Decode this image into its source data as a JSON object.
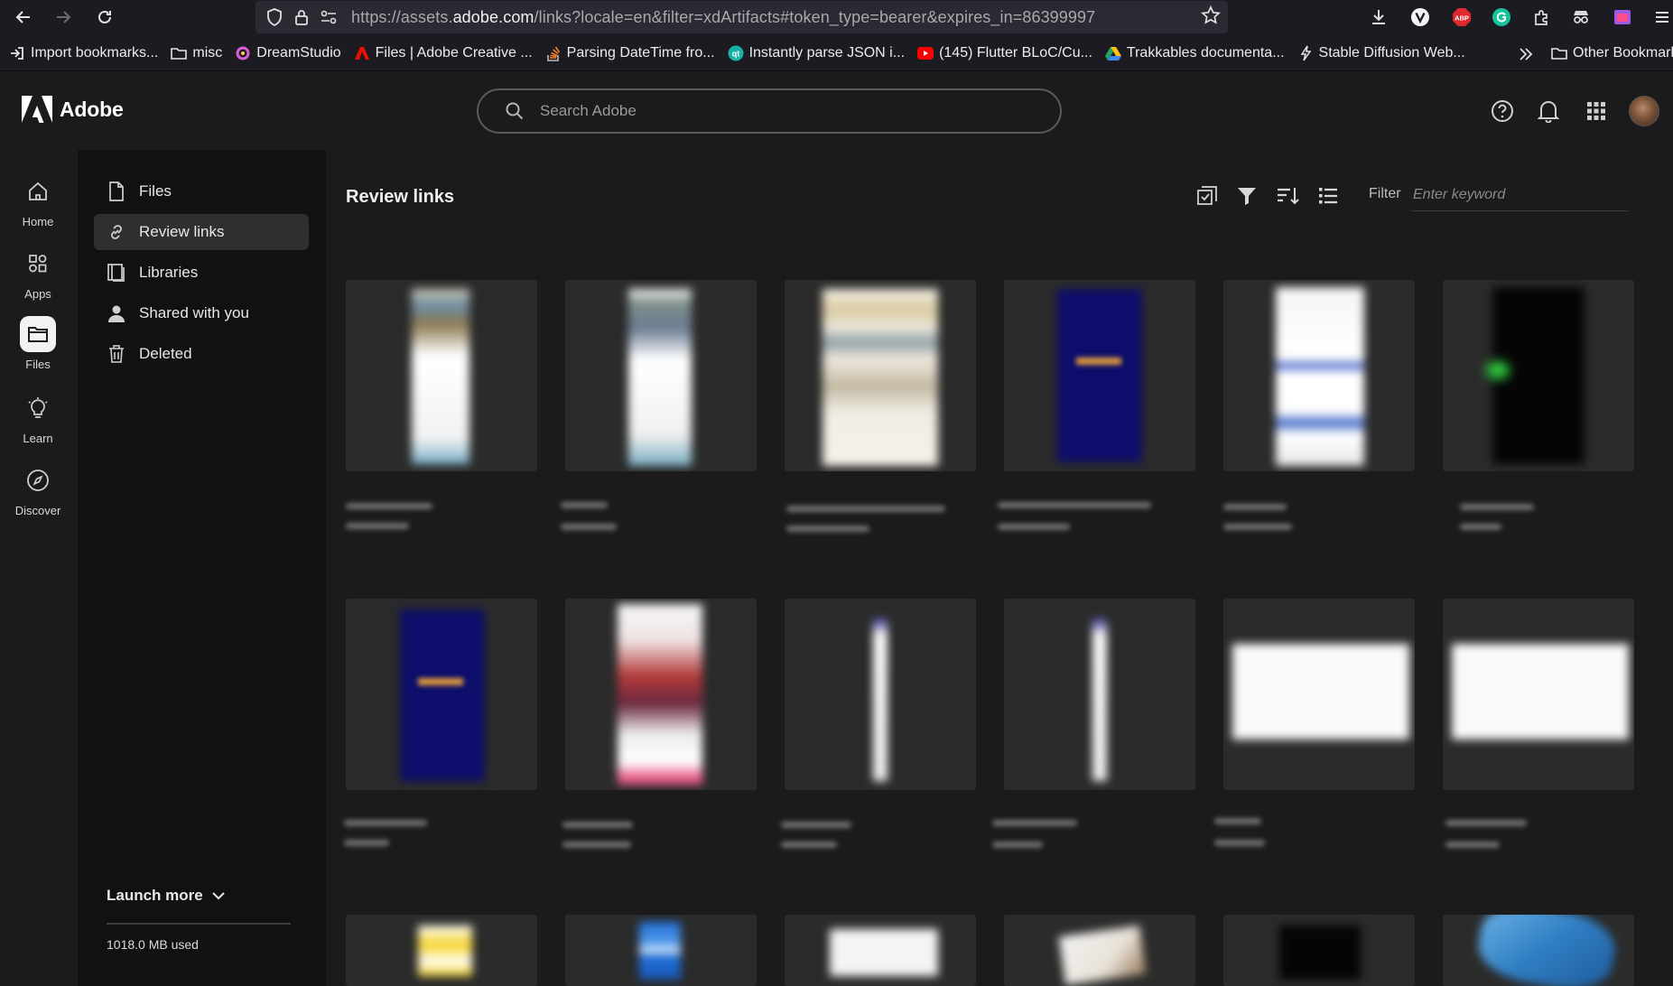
{
  "browser": {
    "url_prefix": "https://assets.",
    "url_domain": "adobe.com",
    "url_path": "/links?locale=en&filter=xdArtifacts#token_type=bearer&expires_in=86399997",
    "bookmarks": [
      {
        "label": "Import bookmarks..."
      },
      {
        "label": "misc"
      },
      {
        "label": "DreamStudio"
      },
      {
        "label": "Files | Adobe Creative ..."
      },
      {
        "label": "Parsing DateTime fro..."
      },
      {
        "label": "Instantly parse JSON i..."
      },
      {
        "label": "(145) Flutter BLoC/Cu..."
      },
      {
        "label": "Trakkables documenta..."
      },
      {
        "label": "Stable Diffusion Web..."
      }
    ],
    "other_bookmarks": "Other Bookmarks"
  },
  "header": {
    "brand": "Adobe",
    "search_placeholder": "Search Adobe"
  },
  "rail": {
    "items": [
      {
        "label": "Home"
      },
      {
        "label": "Apps"
      },
      {
        "label": "Files"
      },
      {
        "label": "Learn"
      },
      {
        "label": "Discover"
      }
    ]
  },
  "panel": {
    "items": [
      {
        "label": "Files"
      },
      {
        "label": "Review links"
      },
      {
        "label": "Libraries"
      },
      {
        "label": "Shared with you"
      },
      {
        "label": "Deleted"
      }
    ],
    "launch_more": "Launch more",
    "storage_used": "1018.0 MB used"
  },
  "main": {
    "title": "Review links",
    "filter_label": "Filter",
    "filter_placeholder": "Enter keyword"
  },
  "colors": {
    "background": "#1b1b1b",
    "panel": "#111111",
    "card": "#2b2b2b",
    "accent_active": "#2f2f2f"
  }
}
